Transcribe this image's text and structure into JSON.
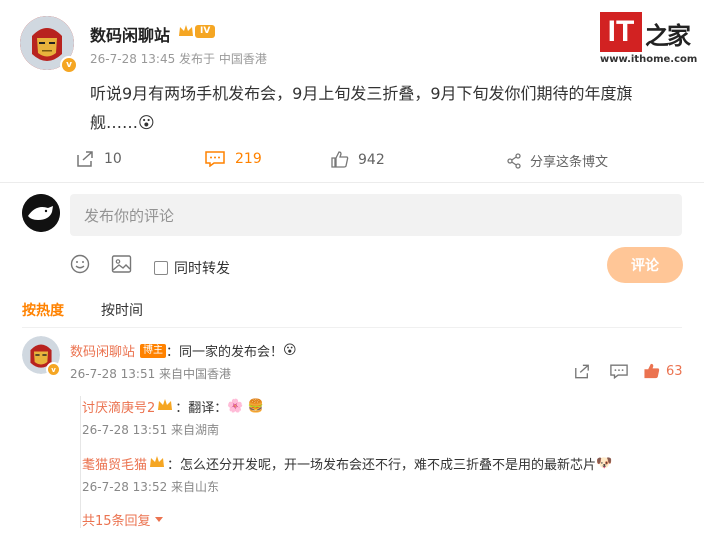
{
  "post": {
    "author": "数码闲聊站",
    "level_badge": "IV",
    "verified_badge": "v",
    "meta": "26-7-28 13:45 发布于 中国香港",
    "content_line1": "听说9月有两场手机发布会，9月上旬发三折叠，9月下旬发你们期待的年度旗",
    "content_line2": "舰……",
    "emoji": "😮",
    "reposts": "10",
    "comments": "219",
    "likes": "942",
    "share_label": "分享这条博文"
  },
  "watermark": {
    "logo_it": "IT",
    "logo_home": "之家",
    "url": "www.ithome.com"
  },
  "composer": {
    "placeholder": "发布你的评论",
    "repost_label": "同时转发",
    "submit_label": "评论"
  },
  "sort": {
    "hot": "按热度",
    "time": "按时间"
  },
  "comment": {
    "author": "数码闲聊站",
    "badge": "博主",
    "text": "：同一家的发布会！",
    "emoji": "😮",
    "meta": "26-7-28 13:51 来自中国香港",
    "likes": "63"
  },
  "replies": [
    {
      "author": "讨厌滴庚号2",
      "text": "：翻译：",
      "emoji": "🌸 🍔",
      "meta": "26-7-28 13:51 来自湖南"
    },
    {
      "author": "耄猫贸毛猫",
      "text": "：怎么还分开发呢，开一场发布会还不行，难不成三折叠不是用的最新芯片",
      "emoji": "🐶",
      "meta": "26-7-28 13:52 来自山东"
    }
  ],
  "more_replies": "共15条回复",
  "colors": {
    "accent": "#ff8200",
    "link": "#eb7350",
    "button": "#ffc697",
    "logo_red": "#d22222"
  }
}
